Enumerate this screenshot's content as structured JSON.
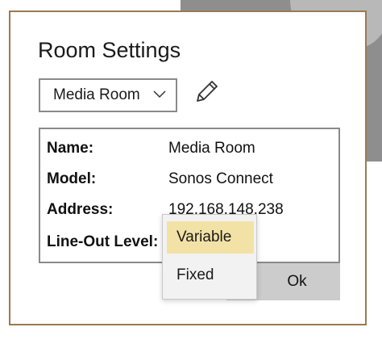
{
  "dialog": {
    "title": "Room Settings",
    "room_select": {
      "value": "Media Room"
    },
    "info": {
      "rows": [
        {
          "label": "Name:",
          "value": "Media Room"
        },
        {
          "label": "Model:",
          "value": "Sonos Connect"
        },
        {
          "label": "Address:",
          "value": "192.168.148.238"
        },
        {
          "label": "Line-Out Level:",
          "value": ""
        }
      ]
    },
    "ok_label": "Ok",
    "line_out_dropdown": {
      "options": [
        "Variable",
        "Fixed"
      ],
      "selected": "Variable"
    }
  },
  "icons": {
    "chevron": "chevron-down-icon",
    "edit": "pencil-icon"
  },
  "colors": {
    "dialog_border": "#9a7a52",
    "selected_option": "#f3e2a6",
    "ok_button": "#cccccc"
  }
}
